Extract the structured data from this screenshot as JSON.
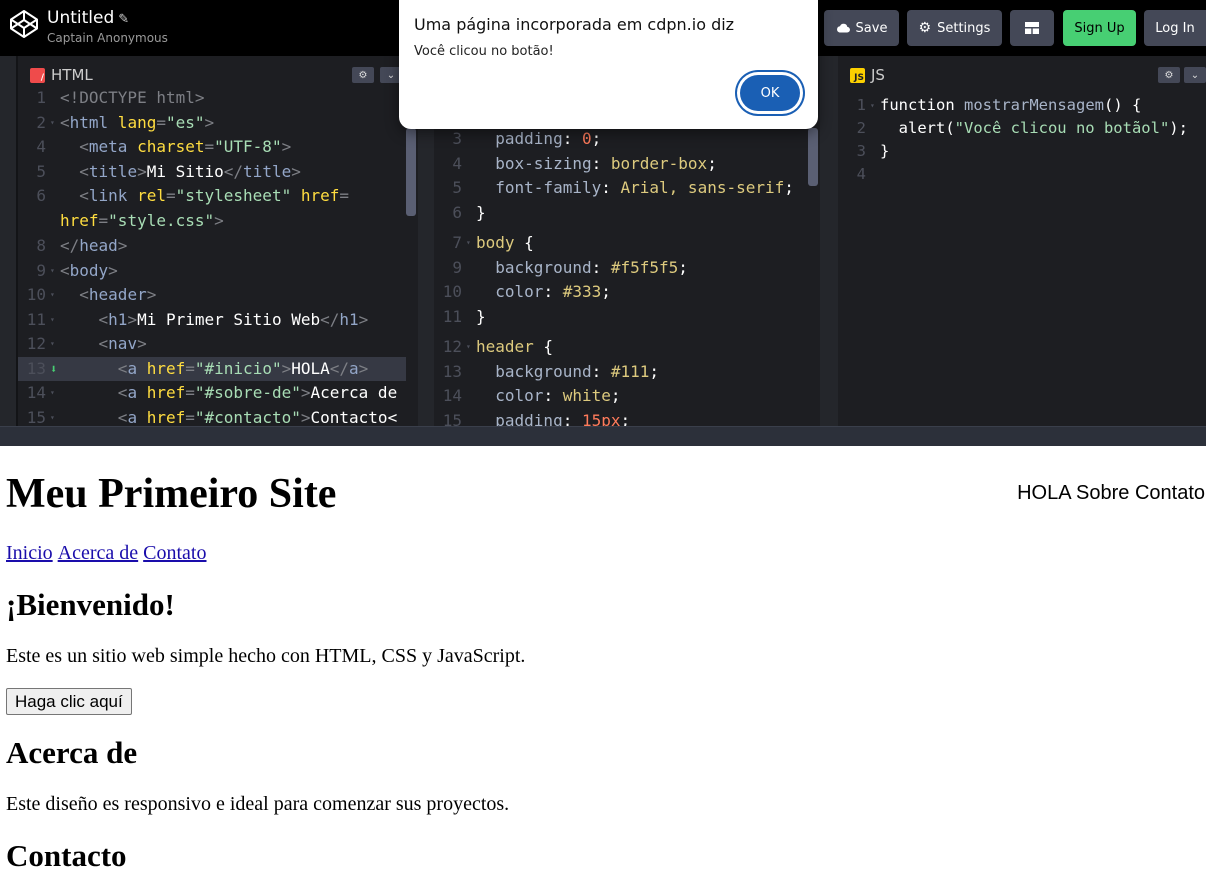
{
  "topbar": {
    "pen_title": "Untitled",
    "author": "Captain Anonymous",
    "save_label": "Save",
    "settings_label": "Settings",
    "signup_label": "Sign Up",
    "login_label": "Log In",
    "signup_color": "#47cf73"
  },
  "editors": {
    "html": {
      "tab_label": "HTML",
      "lines": [
        {
          "n": "1",
          "fold": "",
          "tokens": [
            {
              "c": "p",
              "t": "<!DOCTYPE html>"
            }
          ]
        },
        {
          "n": "2",
          "fold": "▾",
          "tokens": [
            {
              "c": "p",
              "t": "<"
            },
            {
              "c": "t",
              "t": "html"
            },
            {
              "c": "a",
              "t": " lang"
            },
            {
              "c": "p",
              "t": "="
            },
            {
              "c": "s",
              "t": "\"es\""
            },
            {
              "c": "p",
              "t": ">"
            }
          ]
        },
        {
          "n": "4",
          "fold": "",
          "tokens": [
            {
              "c": "p",
              "t": "  <"
            },
            {
              "c": "t",
              "t": "meta"
            },
            {
              "c": "a",
              "t": " charset"
            },
            {
              "c": "p",
              "t": "="
            },
            {
              "c": "s",
              "t": "\"UTF-8\""
            },
            {
              "c": "p",
              "t": ">"
            }
          ]
        },
        {
          "n": "5",
          "fold": "",
          "tokens": [
            {
              "c": "p",
              "t": "  <"
            },
            {
              "c": "t",
              "t": "title"
            },
            {
              "c": "p",
              "t": ">"
            },
            {
              "c": "w",
              "t": "Mi Sitio"
            },
            {
              "c": "p",
              "t": "</"
            },
            {
              "c": "t",
              "t": "title"
            },
            {
              "c": "p",
              "t": ">"
            }
          ]
        },
        {
          "n": "6",
          "fold": "",
          "tokens": [
            {
              "c": "p",
              "t": "  <"
            },
            {
              "c": "t",
              "t": "link"
            },
            {
              "c": "a",
              "t": " rel"
            },
            {
              "c": "p",
              "t": "="
            },
            {
              "c": "s",
              "t": "\"stylesheet\""
            },
            {
              "c": "a",
              "t": " href"
            },
            {
              "c": "p",
              "t": "="
            }
          ]
        },
        {
          "n": "",
          "fold": "",
          "tokens": [
            {
              "c": "a",
              "t": "href"
            },
            {
              "c": "p",
              "t": "="
            },
            {
              "c": "s",
              "t": "\"style.css\""
            },
            {
              "c": "p",
              "t": ">"
            }
          ]
        },
        {
          "n": "8",
          "fold": "",
          "tokens": [
            {
              "c": "p",
              "t": "</"
            },
            {
              "c": "t",
              "t": "head"
            },
            {
              "c": "p",
              "t": ">"
            }
          ]
        },
        {
          "n": "9",
          "fold": "▾",
          "tokens": [
            {
              "c": "p",
              "t": "<"
            },
            {
              "c": "t",
              "t": "body"
            },
            {
              "c": "p",
              "t": ">"
            }
          ]
        },
        {
          "n": "10",
          "fold": "▾",
          "tokens": [
            {
              "c": "p",
              "t": "  <"
            },
            {
              "c": "t",
              "t": "header"
            },
            {
              "c": "p",
              "t": ">"
            }
          ]
        },
        {
          "n": "11",
          "fold": "▾",
          "tokens": [
            {
              "c": "p",
              "t": "    <"
            },
            {
              "c": "t",
              "t": "h1"
            },
            {
              "c": "p",
              "t": ">"
            },
            {
              "c": "w",
              "t": "Mi Primer Sitio Web"
            },
            {
              "c": "p",
              "t": "</"
            },
            {
              "c": "t",
              "t": "h1"
            },
            {
              "c": "p",
              "t": ">"
            }
          ]
        },
        {
          "n": "12",
          "fold": "▾",
          "tokens": [
            {
              "c": "p",
              "t": "    <"
            },
            {
              "c": "t",
              "t": "nav"
            },
            {
              "c": "p",
              "t": ">"
            }
          ]
        },
        {
          "n": "13",
          "fold": "",
          "hl": true,
          "tokens": [
            {
              "c": "p",
              "t": "      <"
            },
            {
              "c": "t",
              "t": "a"
            },
            {
              "c": "a",
              "t": " href"
            },
            {
              "c": "p",
              "t": "="
            },
            {
              "c": "s",
              "t": "\"#inicio\""
            },
            {
              "c": "p",
              "t": ">"
            },
            {
              "c": "w",
              "t": "HOLA"
            },
            {
              "c": "p",
              "t": "</"
            },
            {
              "c": "t",
              "t": "a"
            },
            {
              "c": "p",
              "t": ">"
            }
          ]
        },
        {
          "n": "14",
          "fold": "▾",
          "tokens": [
            {
              "c": "p",
              "t": "      <"
            },
            {
              "c": "t",
              "t": "a"
            },
            {
              "c": "a",
              "t": " href"
            },
            {
              "c": "p",
              "t": "="
            },
            {
              "c": "s",
              "t": "\"#sobre-de\""
            },
            {
              "c": "p",
              "t": ">"
            },
            {
              "c": "w",
              "t": "Acerca de"
            }
          ]
        },
        {
          "n": "15",
          "fold": "▾",
          "tokens": [
            {
              "c": "p",
              "t": "      <"
            },
            {
              "c": "t",
              "t": "a"
            },
            {
              "c": "a",
              "t": " href"
            },
            {
              "c": "p",
              "t": "="
            },
            {
              "c": "s",
              "t": "\"#contacto\""
            },
            {
              "c": "p",
              "t": ">"
            },
            {
              "c": "w",
              "t": "Contacto<"
            }
          ]
        }
      ]
    },
    "css": {
      "lines": [
        {
          "n": "3",
          "fold": "",
          "tokens": [
            {
              "c": "prop",
              "t": "  padding"
            },
            {
              "c": "w",
              "t": ": "
            },
            {
              "c": "n",
              "t": "0"
            },
            {
              "c": "w",
              "t": ";"
            }
          ]
        },
        {
          "n": "4",
          "fold": "",
          "tokens": [
            {
              "c": "prop",
              "t": "  box-sizing"
            },
            {
              "c": "w",
              "t": ": "
            },
            {
              "c": "v",
              "t": "border-box"
            },
            {
              "c": "w",
              "t": ";"
            }
          ]
        },
        {
          "n": "5",
          "fold": "",
          "tokens": [
            {
              "c": "prop",
              "t": "  font-family"
            },
            {
              "c": "w",
              "t": ": "
            },
            {
              "c": "v",
              "t": "Arial, sans-serif"
            },
            {
              "c": "w",
              "t": ";"
            }
          ]
        },
        {
          "n": "6",
          "fold": "",
          "tokens": [
            {
              "c": "w",
              "t": "}"
            }
          ]
        },
        {
          "n": "7",
          "fold": "▾",
          "tokens": [
            {
              "c": "sel",
              "t": "body"
            },
            {
              "c": "w",
              "t": " {"
            }
          ]
        },
        {
          "n": "9",
          "fold": "",
          "tokens": [
            {
              "c": "prop",
              "t": "  background"
            },
            {
              "c": "w",
              "t": ": "
            },
            {
              "c": "v",
              "t": "#f5f5f5"
            },
            {
              "c": "w",
              "t": ";"
            }
          ]
        },
        {
          "n": "10",
          "fold": "",
          "tokens": [
            {
              "c": "prop",
              "t": "  color"
            },
            {
              "c": "w",
              "t": ": "
            },
            {
              "c": "v",
              "t": "#333"
            },
            {
              "c": "w",
              "t": ";"
            }
          ]
        },
        {
          "n": "11",
          "fold": "",
          "tokens": [
            {
              "c": "w",
              "t": "}"
            }
          ]
        },
        {
          "n": "12",
          "fold": "▾",
          "tokens": [
            {
              "c": "sel",
              "t": "header"
            },
            {
              "c": "w",
              "t": " {"
            }
          ]
        },
        {
          "n": "13",
          "fold": "",
          "tokens": [
            {
              "c": "prop",
              "t": "  background"
            },
            {
              "c": "w",
              "t": ": "
            },
            {
              "c": "v",
              "t": "#111"
            },
            {
              "c": "w",
              "t": ";"
            }
          ]
        },
        {
          "n": "14",
          "fold": "",
          "tokens": [
            {
              "c": "prop",
              "t": "  color"
            },
            {
              "c": "w",
              "t": ": "
            },
            {
              "c": "v",
              "t": "white"
            },
            {
              "c": "w",
              "t": ";"
            }
          ]
        },
        {
          "n": "15",
          "fold": "",
          "tokens": [
            {
              "c": "prop",
              "t": "  padding"
            },
            {
              "c": "w",
              "t": ": "
            },
            {
              "c": "n",
              "t": "15px"
            },
            {
              "c": "w",
              "t": ";"
            }
          ]
        }
      ]
    },
    "js": {
      "tab_label": "JS",
      "lines": [
        {
          "n": "1",
          "fold": "▾",
          "tokens": [
            {
              "c": "w",
              "t": "function "
            },
            {
              "c": "prop",
              "t": "mostrarMensagem"
            },
            {
              "c": "w",
              "t": "() {"
            }
          ]
        },
        {
          "n": "2",
          "fold": "",
          "tokens": [
            {
              "c": "w",
              "t": "  alert("
            },
            {
              "c": "s",
              "t": "\"Você clicou no botãol\""
            },
            {
              "c": "w",
              "t": ");"
            }
          ]
        },
        {
          "n": "3",
          "fold": "",
          "tokens": [
            {
              "c": "w",
              "t": "}"
            }
          ]
        },
        {
          "n": "4",
          "fold": "",
          "tokens": []
        }
      ]
    }
  },
  "preview": {
    "heading": "Meu Primeiro Site",
    "top_nav": "HOLA Sobre Contato",
    "links": [
      "Inicio",
      "Acerca de",
      "Contato"
    ],
    "welcome_heading": "¡Bienvenido!",
    "welcome_text": "Este es un sitio web simple hecho con HTML, CSS y JavaScript.",
    "button_label": "Haga clic aquí",
    "about_heading": "Acerca de",
    "about_text": "Este diseño es responsivo e ideal para comenzar sus proyectos.",
    "contact_heading": "Contacto"
  },
  "alert": {
    "title": "Uma página incorporada em cdpn.io diz",
    "message": "Você clicou no botão!",
    "ok_label": "OK"
  }
}
